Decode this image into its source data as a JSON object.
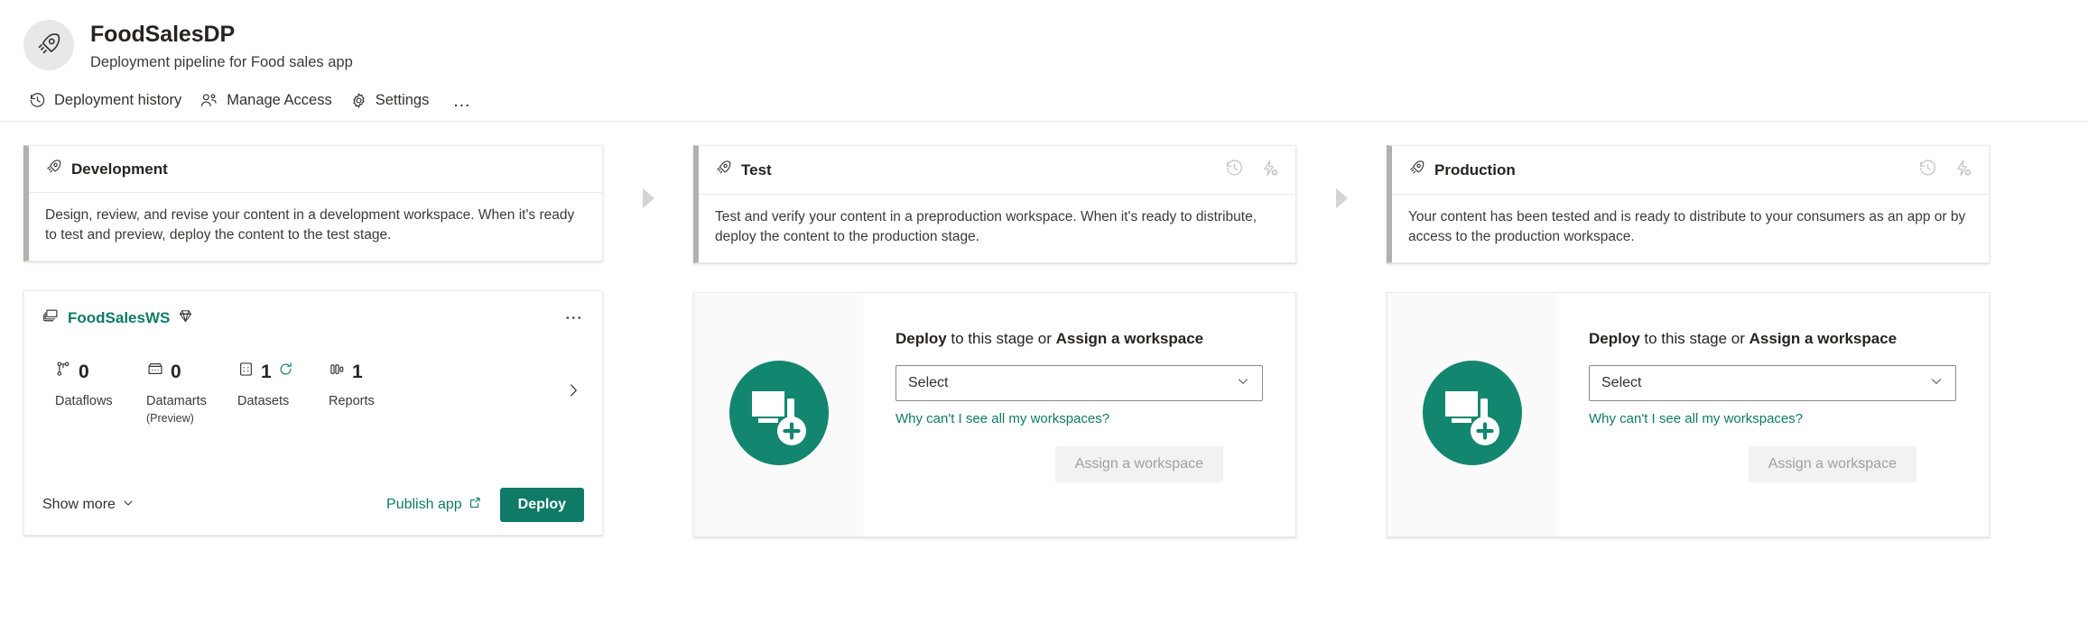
{
  "header": {
    "app_icon": "rocket-icon",
    "title": "FoodSalesDP",
    "subtitle": "Deployment pipeline for Food sales app"
  },
  "command_bar": {
    "items": [
      {
        "label": "Deployment history",
        "icon": "history-icon"
      },
      {
        "label": "Manage Access",
        "icon": "people-icon"
      },
      {
        "label": "Settings",
        "icon": "gear-icon"
      }
    ],
    "overflow_label": "…"
  },
  "stages": [
    {
      "name": "Development",
      "icon": "rocket-icon",
      "description": "Design, review, and revise your content in a development workspace. When it's ready to test and preview, deploy the content to the test stage.",
      "has_head_actions": false
    },
    {
      "name": "Test",
      "icon": "rocket-icon",
      "description": "Test and verify your content in a preproduction workspace. When it's ready to distribute, deploy the content to the production stage.",
      "has_head_actions": true
    },
    {
      "name": "Production",
      "icon": "rocket-icon",
      "description": "Your content has been tested and is ready to distribute to your consumers as an app or by access to the production workspace.",
      "has_head_actions": true
    }
  ],
  "stage_actions": {
    "history_icon": "deployment-history-icon",
    "rules_icon": "deployment-rules-icon"
  },
  "workspace": {
    "icon": "workspace-icon",
    "name": "FoodSalesWS",
    "premium_icon": "diamond-icon",
    "more_menu": "⋮",
    "metrics": [
      {
        "icon": "dataflow-icon",
        "count": "0",
        "label": "Dataflows",
        "sub": "",
        "refresh": false
      },
      {
        "icon": "datamart-icon",
        "count": "0",
        "label": "Datamarts",
        "sub": "(Preview)",
        "refresh": false
      },
      {
        "icon": "dataset-icon",
        "count": "1",
        "label": "Datasets",
        "sub": "",
        "refresh": true
      },
      {
        "icon": "report-icon",
        "count": "1",
        "label": "Reports",
        "sub": "",
        "refresh": false
      }
    ],
    "next_icon": "chevron-right-icon",
    "show_more_label": "Show more",
    "show_more_icon": "chevron-down-icon",
    "publish_app_label": "Publish app",
    "publish_app_icon": "external-link-icon",
    "deploy_label": "Deploy"
  },
  "empty_state": {
    "art_icon": "add-workspace-icon",
    "title_lead": "Deploy",
    "title_mid": " to this stage or ",
    "title_end": "Assign a workspace",
    "select_value": "Select",
    "select_chevron": "chevron-down-icon",
    "help_link": "Why can't I see all my workspaces?",
    "assign_label": "Assign a workspace"
  },
  "separator": {
    "icon": "arrow-right-icon"
  },
  "colors": {
    "brand_teal": "#0f7a66",
    "stage_accent": "#b3b0ad",
    "card_border": "#edebe9",
    "disabled_text": "#a19f9d",
    "arrow_gray": "#d6d4d2"
  }
}
